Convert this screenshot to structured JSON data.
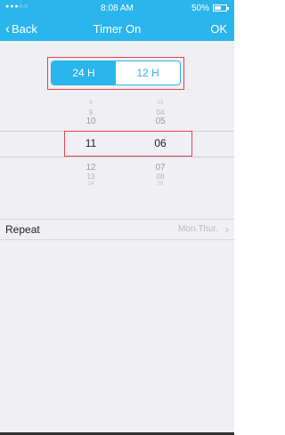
{
  "status_bar": {
    "signal": "●●●○○",
    "time": "8:08 AM",
    "battery": "50%"
  },
  "nav": {
    "back_label": "Back",
    "title": "Timer On",
    "ok_label": "OK"
  },
  "segmented": {
    "options": [
      "24 H",
      "12 H"
    ],
    "selected": "24 H"
  },
  "picker": {
    "hours": [
      "8",
      "9",
      "10",
      "11",
      "12",
      "13",
      "14"
    ],
    "minutes": [
      "03",
      "04",
      "05",
      "06",
      "07",
      "08",
      "09"
    ],
    "selected_hour": "11",
    "selected_minute": "06"
  },
  "repeat": {
    "label": "Repeat",
    "value": "Mon.Thur."
  },
  "colors": {
    "accent": "#2ab5ec",
    "highlight": "#e4454f",
    "background": "#efeff4"
  }
}
